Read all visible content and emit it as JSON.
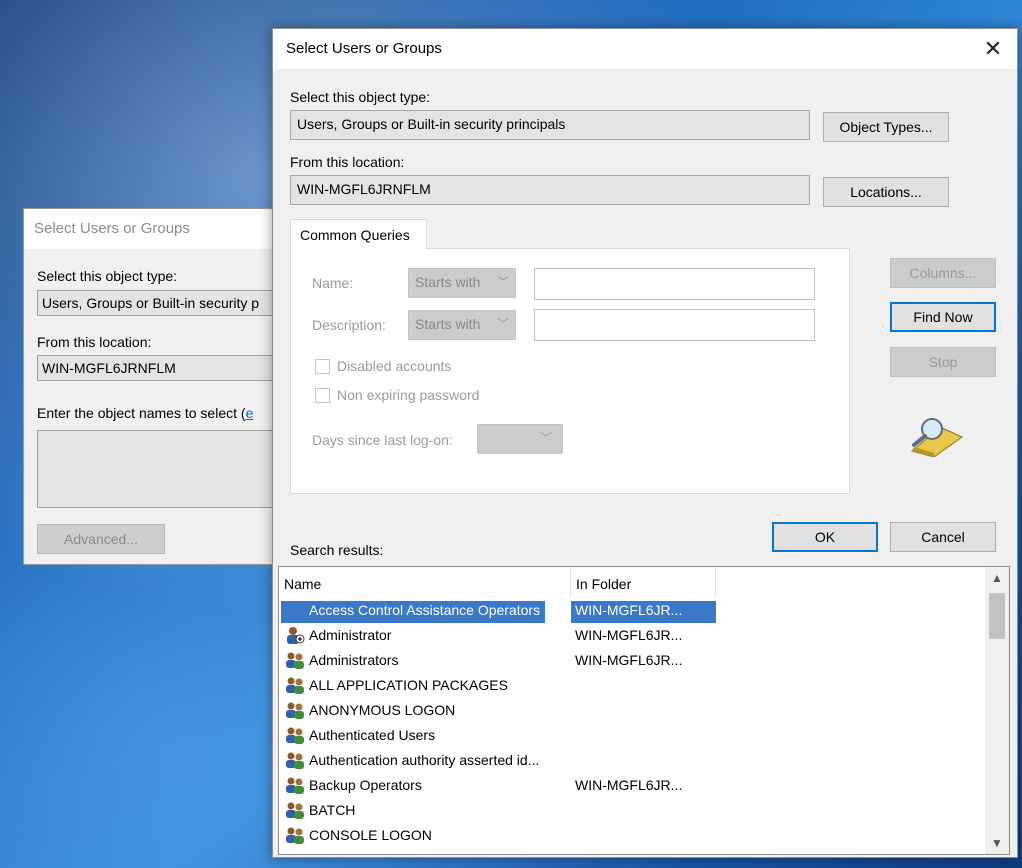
{
  "background_dialog": {
    "title": "Select Users or Groups",
    "object_type_label": "Select this object type:",
    "object_type_value": "Users, Groups or Built-in security p",
    "location_label": "From this location:",
    "location_value": "WIN-MGFL6JRNFLM",
    "enter_names_label": "Enter the object names to select (",
    "enter_names_link": "e",
    "advanced_button": "Advanced..."
  },
  "dialog": {
    "title": "Select Users or Groups",
    "close_glyph": "✕",
    "object_type_label": "Select this object type:",
    "object_type_value": "Users, Groups or Built-in security principals",
    "object_types_button": "Object Types...",
    "location_label": "From this location:",
    "location_value": "WIN-MGFL6JRNFLM",
    "locations_button": "Locations...",
    "tab_label": "Common Queries",
    "name_label": "Name:",
    "name_combo": "Starts with",
    "description_label": "Description:",
    "description_combo": "Starts with",
    "disabled_accounts_label": "Disabled accounts",
    "non_expiring_label": "Non expiring password",
    "days_since_label": "Days since last log-on:",
    "columns_button": "Columns...",
    "find_now_button": "Find Now",
    "stop_button": "Stop",
    "ok_button": "OK",
    "cancel_button": "Cancel",
    "search_results_label": "Search results:"
  },
  "results": {
    "columns": [
      "Name",
      "In Folder"
    ],
    "rows": [
      {
        "name": "Access Control Assistance Operators",
        "folder": "WIN-MGFL6JR...",
        "icon": "group-icon",
        "selected": true
      },
      {
        "name": "Administrator",
        "folder": "WIN-MGFL6JR...",
        "icon": "user-icon",
        "selected": false
      },
      {
        "name": "Administrators",
        "folder": "WIN-MGFL6JR...",
        "icon": "group-icon",
        "selected": false
      },
      {
        "name": "ALL APPLICATION PACKAGES",
        "folder": "",
        "icon": "group-icon",
        "selected": false
      },
      {
        "name": "ANONYMOUS LOGON",
        "folder": "",
        "icon": "group-icon",
        "selected": false
      },
      {
        "name": "Authenticated Users",
        "folder": "",
        "icon": "group-icon",
        "selected": false
      },
      {
        "name": "Authentication authority asserted id...",
        "folder": "",
        "icon": "group-icon",
        "selected": false
      },
      {
        "name": "Backup Operators",
        "folder": "WIN-MGFL6JR...",
        "icon": "group-icon",
        "selected": false
      },
      {
        "name": "BATCH",
        "folder": "",
        "icon": "group-icon",
        "selected": false
      },
      {
        "name": "CONSOLE LOGON",
        "folder": "",
        "icon": "group-icon",
        "selected": false
      }
    ]
  },
  "colors": {
    "accent": "#0078d7",
    "selection": "#3a78c8",
    "dialog_bg": "#f0f0f0"
  }
}
